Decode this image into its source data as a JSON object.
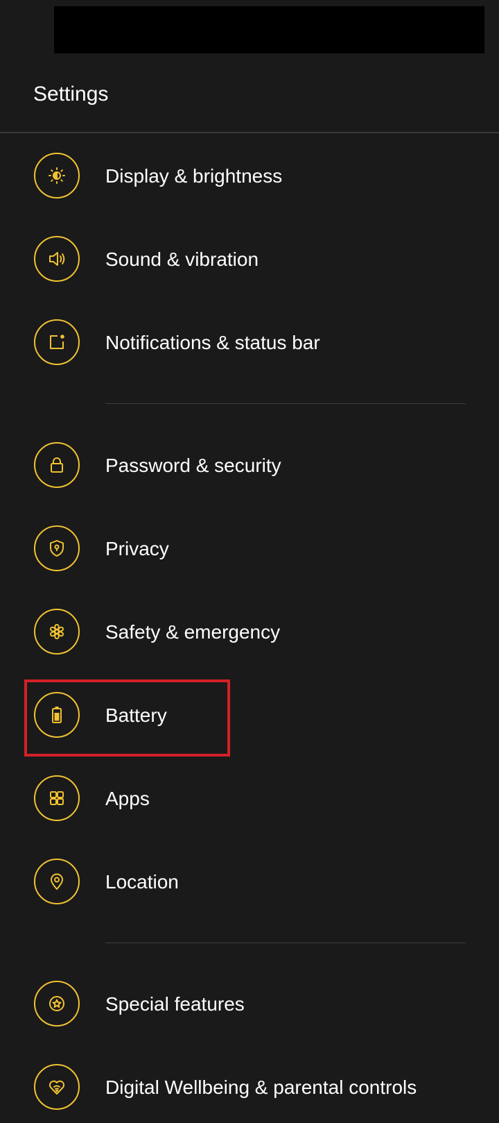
{
  "header": {
    "title": "Settings"
  },
  "colors": {
    "background": "#1a1a1a",
    "accent": "#f1c232",
    "highlight": "#d32027",
    "text": "#ffffff",
    "divider": "#3e3e3e"
  },
  "settings": {
    "items": [
      {
        "label": "Display & brightness",
        "icon": "brightness-icon"
      },
      {
        "label": "Sound & vibration",
        "icon": "speaker-icon"
      },
      {
        "label": "Notifications & status bar",
        "icon": "notification-icon"
      },
      {
        "label": "Password & security",
        "icon": "lock-icon"
      },
      {
        "label": "Privacy",
        "icon": "shield-icon"
      },
      {
        "label": "Safety & emergency",
        "icon": "asterisk-icon"
      },
      {
        "label": "Battery",
        "icon": "battery-icon",
        "highlighted": true
      },
      {
        "label": "Apps",
        "icon": "apps-grid-icon"
      },
      {
        "label": "Location",
        "icon": "location-pin-icon"
      },
      {
        "label": "Special features",
        "icon": "star-icon"
      },
      {
        "label": "Digital Wellbeing & parental controls",
        "icon": "heart-wifi-icon"
      }
    ]
  }
}
